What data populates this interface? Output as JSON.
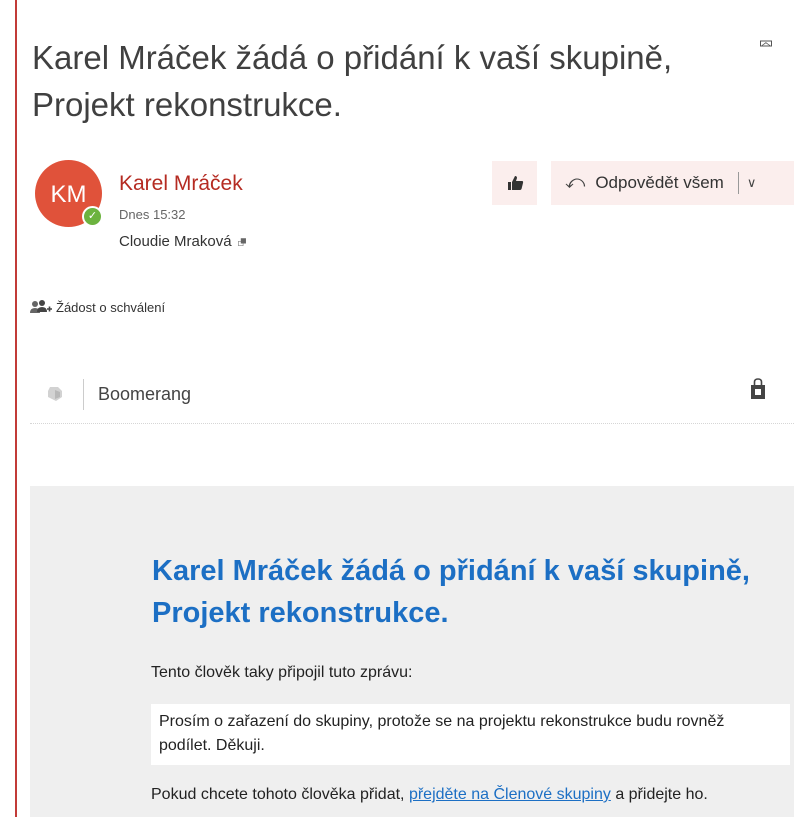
{
  "message": {
    "subject": "Karel Mráček žádá o přidání k vaší skupině, Projekt rekonstrukce.",
    "collapse_icon": "double-chevron-up-icon"
  },
  "sender": {
    "initials": "KM",
    "avatar_color": "#e0523a",
    "presence_status": "available",
    "name": "Karel Mráček",
    "time": "Dnes 15:32",
    "recipient": "Cloudie Mraková",
    "recipient_expand_icon": "double-chevron-down-icon"
  },
  "toolbar": {
    "like_icon": "thumbs-up-icon",
    "reply_all_icon": "reply-all-icon",
    "reply_all_label": "Odpovědět všem",
    "dropdown_icon": "chevron-down-icon"
  },
  "approval": {
    "icon": "people-add-icon",
    "label": "Žádost o schválení"
  },
  "addins": {
    "icon": "boomerang-icon",
    "label": "Boomerang",
    "store_icon": "store-bag-icon"
  },
  "body": {
    "heading": "Karel Mráček žádá o přidání k vaší skupině, Projekt rekonstrukce.",
    "intro": "Tento člověk taky připojil tuto zprávu:",
    "quote": "Prosím o zařazení do skupiny, protože se na projektu rekonstrukce budu rovněž podílet. Děkuji.",
    "action_prefix": "Pokud chcete tohoto člověka přidat,",
    "action_link": "přejděte na Členové skupiny",
    "action_suffix": "a přidejte ho."
  },
  "colors": {
    "accent": "#c23b38",
    "sender_name": "#b52b22",
    "heading_blue": "#1c6fc4",
    "button_bg": "#fbeeed",
    "panel_bg": "#efefef"
  }
}
